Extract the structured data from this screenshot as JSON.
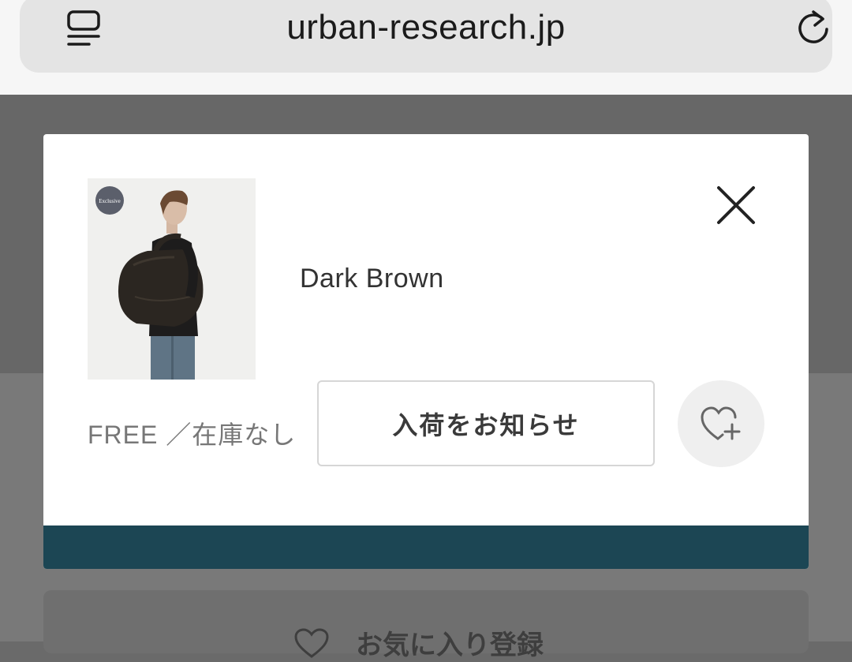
{
  "browser": {
    "url": "urban-research.jp",
    "tabs_icon": "tabs-icon",
    "reload_icon": "reload-icon"
  },
  "modal": {
    "product_badge": "Exclusive",
    "color_name": "Dark Brown",
    "size_stock": "FREE ／在庫なし",
    "notify_button_label": "入荷をお知らせ",
    "favorite_icon": "heart-plus-icon",
    "close_icon": "close-icon",
    "footer_color": "#1c4654"
  },
  "background": {
    "favorite_register_label": "お気に入り登録"
  }
}
